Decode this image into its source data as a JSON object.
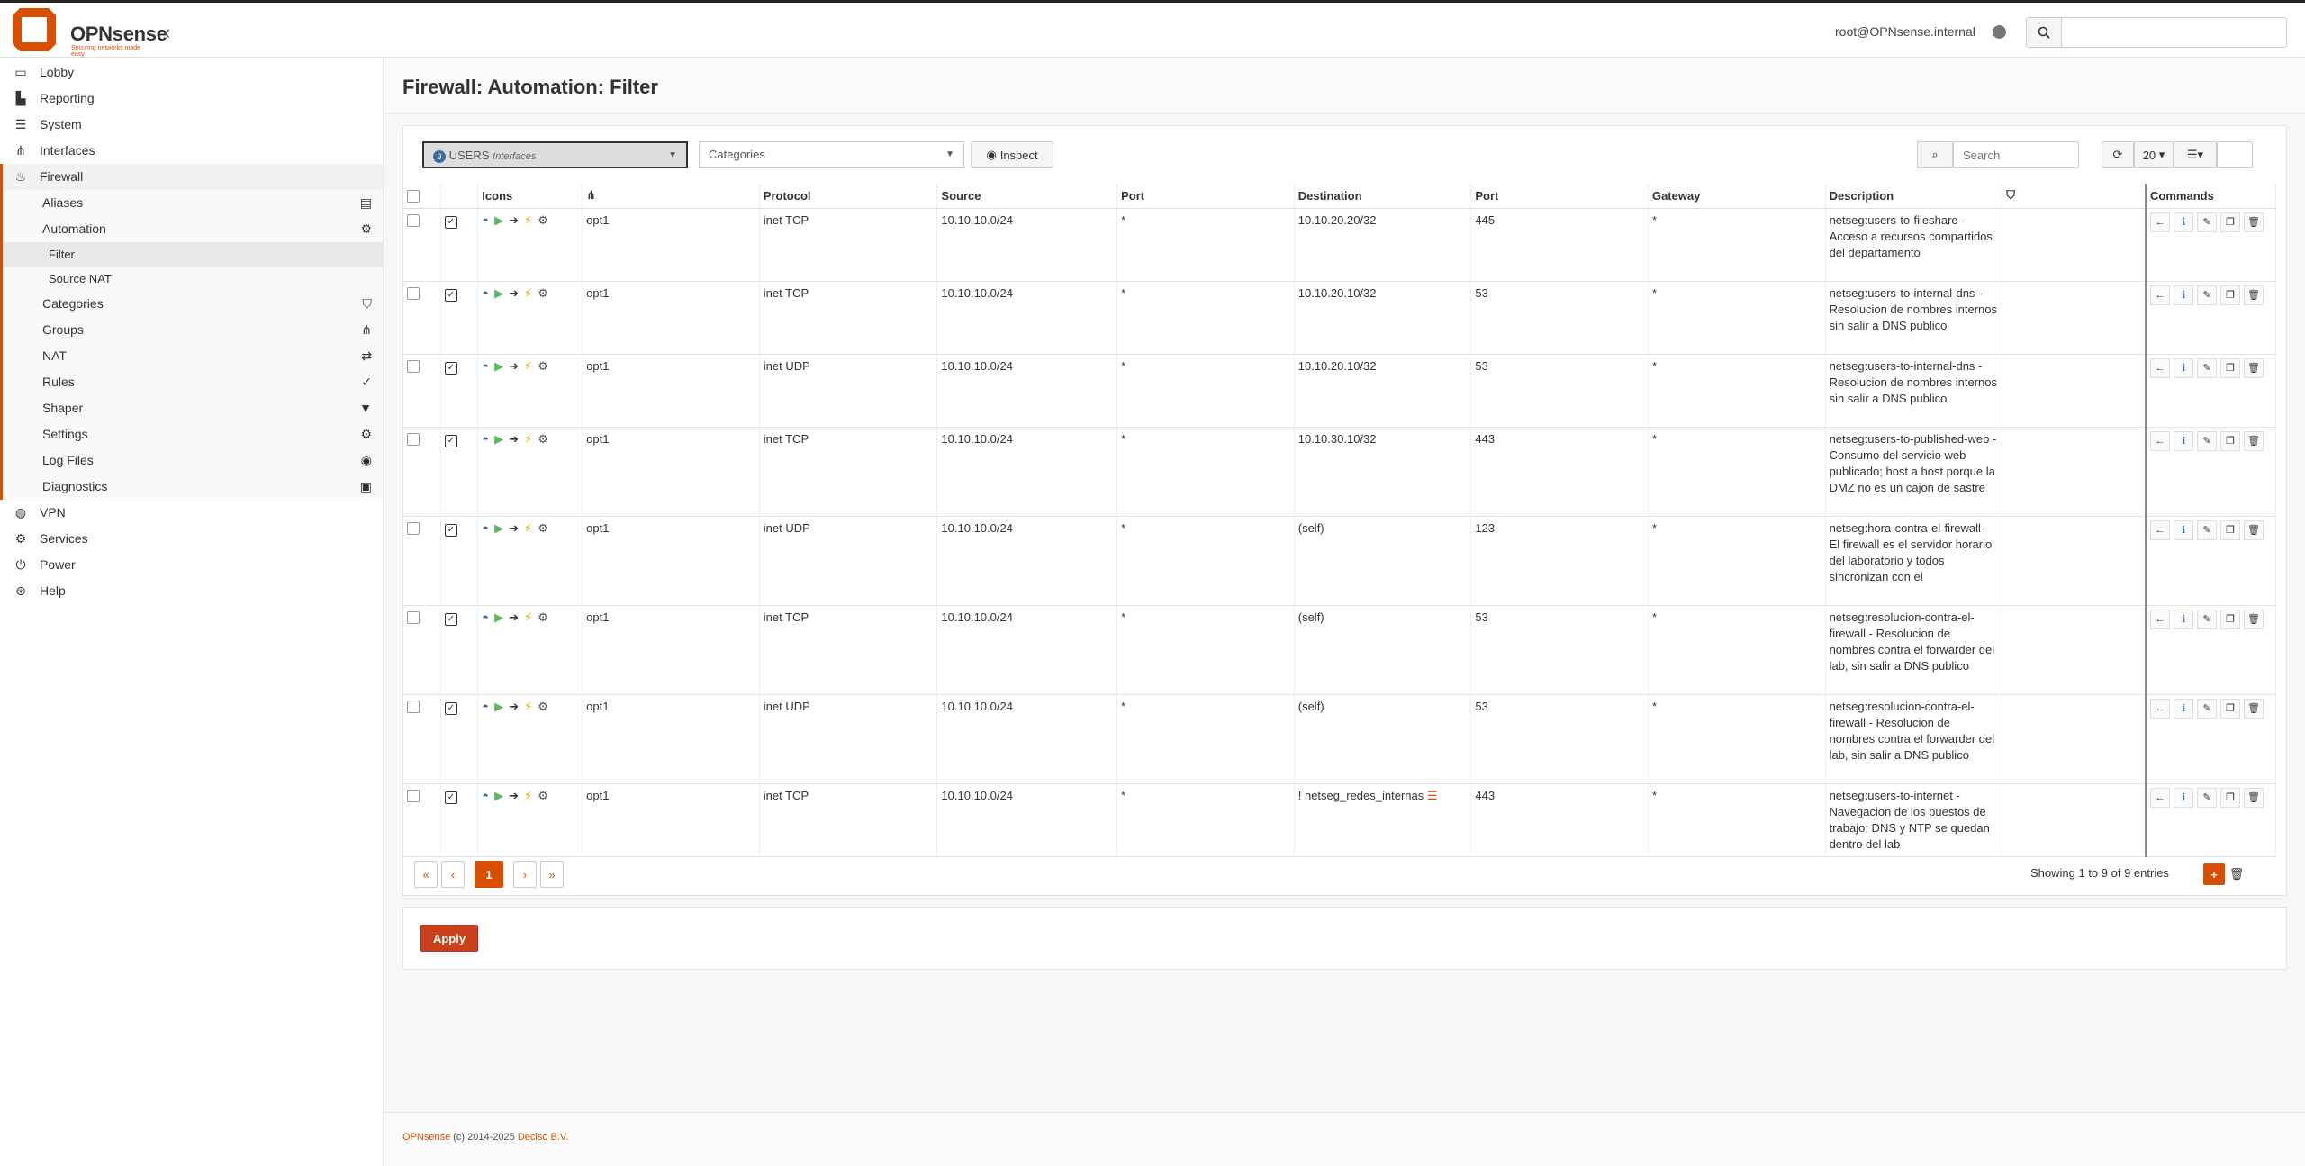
{
  "header": {
    "brand": "OPNsense",
    "tagline": "Securing networks made easy",
    "user": "root@OPNsense.internal",
    "search_placeholder": ""
  },
  "sidebar": {
    "items": [
      {
        "label": "Lobby",
        "icon": "laptop-icon"
      },
      {
        "label": "Reporting",
        "icon": "area-chart-icon"
      },
      {
        "label": "System",
        "icon": "server-icon"
      },
      {
        "label": "Interfaces",
        "icon": "sitemap-icon"
      },
      {
        "label": "Firewall",
        "icon": "fire-icon"
      }
    ],
    "firewall_children": [
      {
        "label": "Aliases",
        "icon": "list-alt-icon"
      },
      {
        "label": "Automation",
        "icon": "cog-icon"
      },
      {
        "label": "Filter"
      },
      {
        "label": "Source NAT"
      },
      {
        "label": "Categories",
        "icon": "tags-icon"
      },
      {
        "label": "Groups",
        "icon": "sitemap-icon"
      },
      {
        "label": "NAT",
        "icon": "exchange-icon"
      },
      {
        "label": "Rules",
        "icon": "check-icon"
      },
      {
        "label": "Shaper",
        "icon": "filter-icon"
      },
      {
        "label": "Settings",
        "icon": "cogs-icon"
      },
      {
        "label": "Log Files",
        "icon": "eye-icon"
      },
      {
        "label": "Diagnostics",
        "icon": "medkit-icon"
      }
    ],
    "bottom_items": [
      {
        "label": "VPN",
        "icon": "globe-icon"
      },
      {
        "label": "Services",
        "icon": "cog-icon"
      },
      {
        "label": "Power",
        "icon": "plug-icon"
      },
      {
        "label": "Help",
        "icon": "support-icon"
      }
    ]
  },
  "page": {
    "title": "Firewall: Automation: Filter",
    "interface_select": "USERS",
    "interface_select_sub": "Interfaces",
    "categories_select": "Categories",
    "inspect_label": "Inspect",
    "search_placeholder": "Search",
    "page_size": "20",
    "apply_label": "Apply",
    "showing": "Showing 1 to 9 of 9 entries",
    "current_page": "1"
  },
  "table": {
    "headers": [
      "Icons",
      "",
      "Protocol",
      "Source",
      "Port",
      "Destination",
      "Port",
      "Gateway",
      "Description",
      "",
      "Commands"
    ],
    "rows": [
      {
        "iface": "opt1",
        "protocol": "inet TCP",
        "source": "10.10.10.0/24",
        "sport": "*",
        "destination": "10.10.20.20/32",
        "dport": "445",
        "gateway": "*",
        "description": "netseg:users-to-fileshare - Acceso a recursos compartidos del departamento"
      },
      {
        "iface": "opt1",
        "protocol": "inet TCP",
        "source": "10.10.10.0/24",
        "sport": "*",
        "destination": "10.10.20.10/32",
        "dport": "53",
        "gateway": "*",
        "description": "netseg:users-to-internal-dns - Resolucion de nombres internos sin salir a DNS publico"
      },
      {
        "iface": "opt1",
        "protocol": "inet UDP",
        "source": "10.10.10.0/24",
        "sport": "*",
        "destination": "10.10.20.10/32",
        "dport": "53",
        "gateway": "*",
        "description": "netseg:users-to-internal-dns - Resolucion de nombres internos sin salir a DNS publico"
      },
      {
        "iface": "opt1",
        "protocol": "inet TCP",
        "source": "10.10.10.0/24",
        "sport": "*",
        "destination": "10.10.30.10/32",
        "dport": "443",
        "gateway": "*",
        "description": "netseg:users-to-published-web - Consumo del servicio web publicado; host a host porque la DMZ no es un cajon de sastre"
      },
      {
        "iface": "opt1",
        "protocol": "inet UDP",
        "source": "10.10.10.0/24",
        "sport": "*",
        "destination": "(self)",
        "dport": "123",
        "gateway": "*",
        "description": "netseg:hora-contra-el-firewall - El firewall es el servidor horario del laboratorio y todos sincronizan con el"
      },
      {
        "iface": "opt1",
        "protocol": "inet TCP",
        "source": "10.10.10.0/24",
        "sport": "*",
        "destination": "(self)",
        "dport": "53",
        "gateway": "*",
        "description": "netseg:resolucion-contra-el-firewall - Resolucion de nombres contra el forwarder del lab, sin salir a DNS publico"
      },
      {
        "iface": "opt1",
        "protocol": "inet UDP",
        "source": "10.10.10.0/24",
        "sport": "*",
        "destination": "(self)",
        "dport": "53",
        "gateway": "*",
        "description": "netseg:resolucion-contra-el-firewall - Resolucion de nombres contra el forwarder del lab, sin salir a DNS publico"
      },
      {
        "iface": "opt1",
        "protocol": "inet TCP",
        "source": "10.10.10.0/24",
        "sport": "*",
        "destination": "! netseg_redes_internas",
        "dport": "443",
        "gateway": "*",
        "description": "netseg:users-to-internet - Navegacion de los puestos de trabajo; DNS y NTP se quedan dentro del lab"
      }
    ]
  },
  "footer": {
    "brand": "OPNsense",
    "copyright": "(c) 2014-2025",
    "company": "Deciso B.V."
  },
  "colors": {
    "accent": "#d94f00",
    "brand_red": "#d94f00"
  }
}
